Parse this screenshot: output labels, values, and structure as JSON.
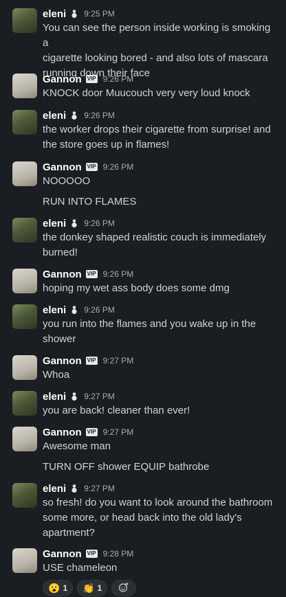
{
  "users": {
    "eleni": {
      "name": "eleni",
      "status_icon": "snowman-icon"
    },
    "gannon": {
      "name": "Gannon",
      "badge": "VIP"
    }
  },
  "messages": [
    {
      "author": "eleni",
      "time": "9:25 PM",
      "lines": [
        "You can see the person inside working is smoking a",
        "cigarette looking bored - and also lots of mascara",
        "running down their face"
      ]
    },
    {
      "author": "Gannon",
      "time": "9:26 PM",
      "lines": [
        "KNOCK door Muucouch very very loud knock"
      ]
    },
    {
      "author": "eleni",
      "time": "9:26 PM",
      "lines": [
        "the worker drops their cigarette from surprise! and",
        "the store goes up in flames!"
      ]
    },
    {
      "author": "Gannon",
      "time": "9:26 PM",
      "lines": [
        "NOOOOO"
      ],
      "extra": "RUN INTO FLAMES"
    },
    {
      "author": "eleni",
      "time": "9:26 PM",
      "lines": [
        "the donkey shaped realistic couch is immediately",
        "burned!"
      ]
    },
    {
      "author": "Gannon",
      "time": "9:26 PM",
      "lines": [
        "hoping my wet ass body does some dmg"
      ]
    },
    {
      "author": "eleni",
      "time": "9:26 PM",
      "lines": [
        "you run into the flames and you wake up in the",
        "shower"
      ]
    },
    {
      "author": "Gannon",
      "time": "9:27 PM",
      "lines": [
        "Whoa"
      ]
    },
    {
      "author": "eleni",
      "time": "9:27 PM",
      "lines": [
        "you are back! cleaner than ever!"
      ]
    },
    {
      "author": "Gannon",
      "time": "9:27 PM",
      "lines": [
        "Awesome man"
      ],
      "extra": "TURN OFF shower EQUIP bathrobe"
    },
    {
      "author": "eleni",
      "time": "9:27 PM",
      "lines": [
        "so fresh! do you want to look around the bathroom",
        "some more, or head back into the old lady's",
        "apartment?"
      ]
    },
    {
      "author": "Gannon",
      "time": "9:28 PM",
      "lines": [
        "USE chameleon"
      ]
    }
  ],
  "reactions": [
    {
      "emoji": "😮",
      "icon": "astonished-face-icon",
      "count": "1"
    },
    {
      "emoji": "👏",
      "icon": "clapping-hands-icon",
      "count": "1"
    }
  ],
  "add_reaction_icon": "add-reaction-icon"
}
